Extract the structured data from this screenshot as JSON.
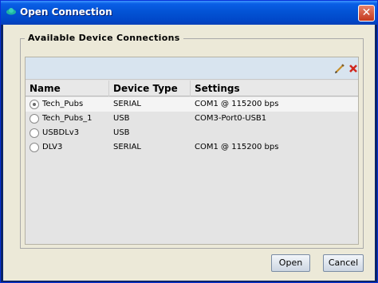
{
  "window": {
    "title": "Open Connection",
    "close_glyph": "✕",
    "title_icon": "device-connection-icon"
  },
  "group": {
    "legend": "Available Device Connections"
  },
  "toolbar": {
    "edit_icon": "pencil-icon",
    "delete_icon": "red-x-delete-icon"
  },
  "table": {
    "columns": [
      "Name",
      "Device Type",
      "Settings"
    ],
    "rows": [
      {
        "name": "Tech_Pubs",
        "type": "SERIAL",
        "settings": "COM1 @ 115200 bps",
        "selected": true
      },
      {
        "name": "Tech_Pubs_1",
        "type": "USB",
        "settings": "COM3-Port0-USB1",
        "selected": false
      },
      {
        "name": "USBDLv3",
        "type": "USB",
        "settings": "",
        "selected": false
      },
      {
        "name": "DLV3",
        "type": "SERIAL",
        "settings": "COM1 @ 115200 bps",
        "selected": false
      }
    ]
  },
  "buttons": {
    "open": "Open",
    "cancel": "Cancel"
  }
}
